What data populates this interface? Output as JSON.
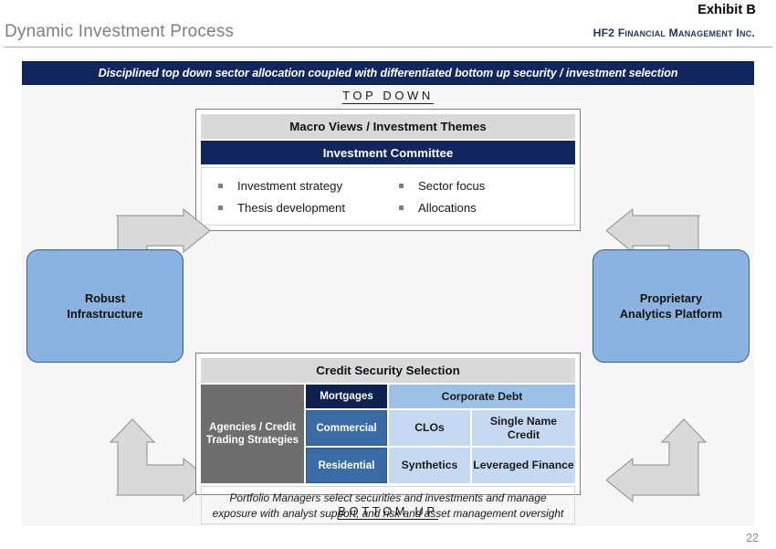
{
  "header": {
    "exhibit": "Exhibit B",
    "title": "Dynamic Investment Process",
    "brand_lead": "HF2",
    "brand_rest": " Financial Management Inc."
  },
  "panel": {
    "banner": "Disciplined top down sector allocation coupled with differentiated bottom up security / investment selection",
    "top_label": "TOP DOWN",
    "bottom_label": "BOTTOM UP"
  },
  "topdown": {
    "macro_header": "Macro Views / Investment Themes",
    "committee_header": "Investment Committee",
    "bullets_left": [
      "Investment strategy",
      "Thesis development"
    ],
    "bullets_right": [
      "Sector focus",
      "Allocations"
    ]
  },
  "sides": {
    "left": {
      "line1": "Robust",
      "line2": "Infrastructure"
    },
    "right": {
      "line1": "Proprietary",
      "line2": "Analytics Platform"
    }
  },
  "selection": {
    "header": "Credit Security Selection",
    "cells": {
      "mortgages": "Mortgages",
      "corporate_debt": "Corporate Debt",
      "agencies": "Agencies / Credit Trading Strategies",
      "commercial": "Commercial",
      "clos": "CLOs",
      "single_name_credit": "Single Name Credit",
      "residential": "Residential",
      "synthetics": "Synthetics",
      "leveraged_finance": "Leveraged Finance"
    },
    "note": "Portfolio Managers select securities and investments and manage exposure with analyst support, and risk and asset management oversight"
  },
  "footer": {
    "page_number": "22"
  },
  "colors": {
    "navy": "#10265c",
    "deep_navy": "#0d2150",
    "steel_blue": "#3b6ba5",
    "mid_blue": "#9dc0e8",
    "light_blue": "#c5d9f1",
    "grey_cell": "#6e6e6e",
    "grey_head": "#d9d9d9",
    "panel_bg": "#f7f7f7",
    "side_box": "#8cb3e0",
    "arrow_fill": "#d9d9d9",
    "title_grey": "#7f7f7f"
  }
}
